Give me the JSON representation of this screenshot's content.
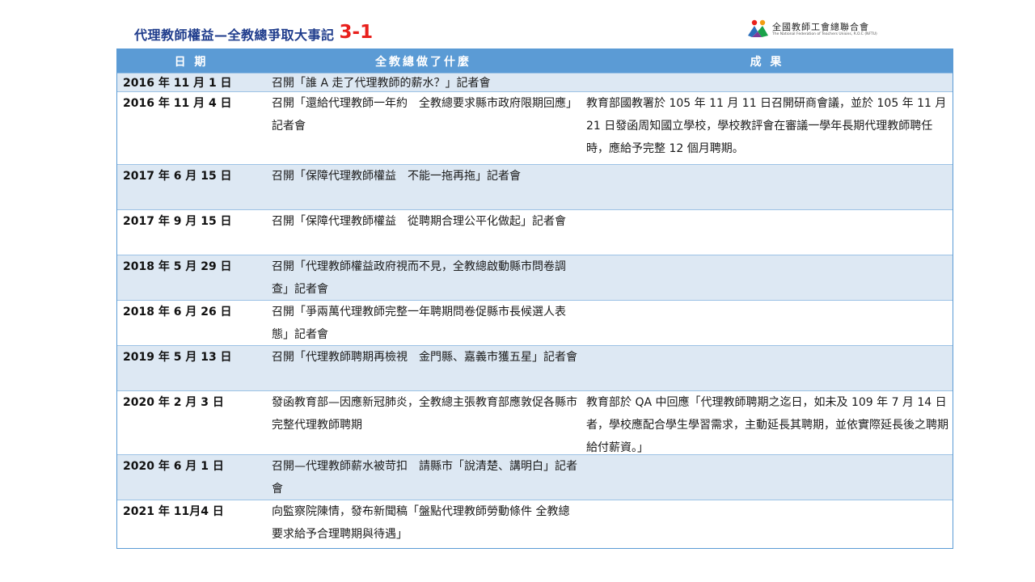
{
  "header": {
    "title": "代理教師權益—全教總爭取大事記",
    "title_number": "3-1"
  },
  "logo": {
    "name_zh": "全國教師工會總聯合會",
    "name_en": "The National Federation of Teachers Unions, R.O.C (NFTU)"
  },
  "table": {
    "headers": [
      "日 期",
      "全教總做了什麼",
      "成 果"
    ],
    "rows": [
      {
        "date": "2016 年 11 月 1 日",
        "action": "召開「誰 A 走了代理教師的薪水？」記者會",
        "result": ""
      },
      {
        "date": "2016 年 11 月 4 日",
        "action": "召開「還給代理教師一年約　全教總要求縣市政府限期回應」記者會",
        "result": "教育部國教署於 105 年 11 月 11 日召開研商會議，並於 105 年 11 月 21 日發函周知國立學校，學校教評會在審議一學年長期代理教師聘任時，應給予完整 12 個月聘期。"
      },
      {
        "date": "2017 年 6 月 15 日",
        "action": "召開「保障代理教師權益　不能一拖再拖」記者會",
        "result": ""
      },
      {
        "date": "2017 年 9 月 15 日",
        "action": "召開「保障代理教師權益　從聘期合理公平化做起」記者會",
        "result": ""
      },
      {
        "date": "2018 年 5 月 29 日",
        "action": "召開「代理教師權益政府視而不見，全教總啟動縣市問卷調查」記者會",
        "result": ""
      },
      {
        "date": "2018 年 6 月 26 日",
        "action": "召開「爭兩萬代理教師完整一年聘期問卷促縣市長候選人表態」記者會",
        "result": ""
      },
      {
        "date": "2019 年 5 月 13 日",
        "action": "召開「代理教師聘期再檢視　金門縣、嘉義市獲五星」記者會",
        "result": ""
      },
      {
        "date": "2020 年 2 月 3 日",
        "action": "發函教育部—因應新冠肺炎，全教總主張教育部應敦促各縣市完整代理教師聘期",
        "result": "教育部於 QA 中回應「代理教師聘期之迄日，如未及 109 年 7 月 14 日者，學校應配合學生學習需求，主動延長其聘期，並依實際延長後之聘期給付薪資。」"
      },
      {
        "date": "2020 年 6 月 1 日",
        "action": "召開—代理教師薪水被苛扣　請縣市「說清楚、講明白」記者會",
        "result": ""
      },
      {
        "date": "2021 年 11月4 日",
        "action": "向監察院陳情，發布新聞稿「盤點代理教師勞動條件 全教總要求給予合理聘期與待遇」",
        "result": ""
      }
    ]
  },
  "colors": {
    "header_bg": "#5b9bd5",
    "stripe_bg": "#dde8f3",
    "title_color": "#1f3c8c",
    "title_number_color": "#e8201c"
  }
}
